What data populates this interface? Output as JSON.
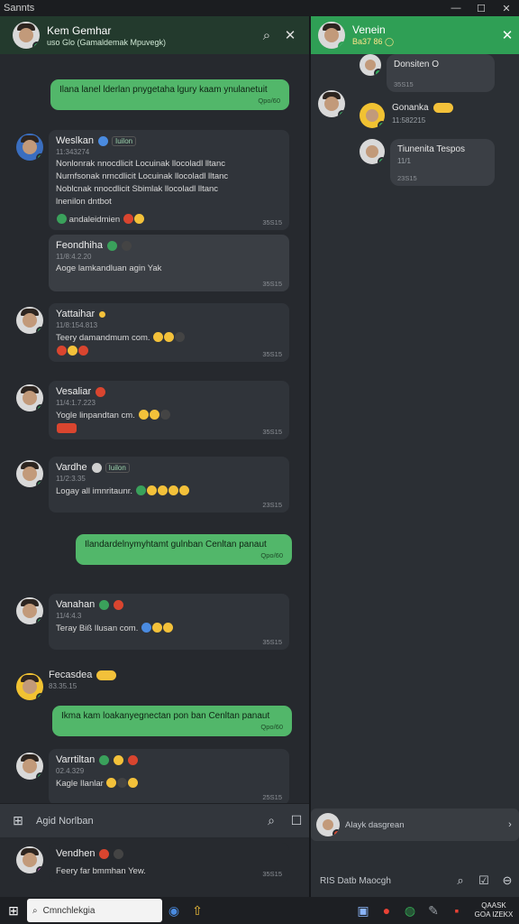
{
  "window": {
    "title": "Sannts",
    "controls": [
      "—",
      "☐",
      "✕"
    ]
  },
  "left_header": {
    "name": "Kem Gemhar",
    "subtitle": "uso Glo (Gamaldemak Mpuvegk)"
  },
  "right_header": {
    "name": "Venein",
    "subtitle": "Ba37 86 ◯"
  },
  "feed": {
    "top_stamp": "",
    "outgoing_1": {
      "text": "Ilana lanel lderlan pnygetaha lgury kaam ynulanetuit",
      "stamp": "Qpo/60"
    },
    "cards": [
      {
        "name": "Weslkan",
        "tag": "Iuilon",
        "time": "11:343274",
        "lines": [
          "Nonlonrak  nnocdlicit Locuinak  llocoladl lltanc",
          "Nurnfsonak  nrncdlicit Locuinak  llocoladl lltanc",
          "Noblcnak  nnocdlicit Sbimlak  llocoladl lltanc",
          "lnenilon  dntbot"
        ],
        "footer": "andaleidmien",
        "stamp": "35S15"
      },
      {
        "name": "Feondhiha",
        "tag": "",
        "time": "11/8:4.2.20",
        "lines": [
          "Aoge lamkandluan agin  Yak"
        ],
        "footer": "",
        "stamp": "35S15"
      },
      {
        "name": "Yattaihar",
        "tag": "",
        "time": "11/8:154.813",
        "lines": [
          "Teery damandmum  com."
        ],
        "footer": "",
        "stamp": "35S15"
      },
      {
        "name": "Vesaliar",
        "tag": "",
        "time": "11/4:1.7.223",
        "lines": [
          "Yogle  linpandtan  cm."
        ],
        "footer": "",
        "stamp": "35S15"
      },
      {
        "name": "Vardhe",
        "tag": "Iuilon",
        "time": "11/2:3.35",
        "lines": [
          "Logay all  imnritaunr."
        ],
        "footer": "",
        "stamp": "23S15"
      },
      {
        "name": "Vanahan",
        "tag": "",
        "time": "11/4:4.3",
        "lines": [
          "Teray  Biß  Ilusan  com."
        ],
        "footer": "",
        "stamp": "35S15"
      },
      {
        "name": "Fecasdea",
        "tag": "",
        "time": "83.35.15",
        "lines": [],
        "footer": "",
        "stamp": ""
      },
      {
        "name": "Varrtiltan",
        "tag": "",
        "time": "02.4.329",
        "lines": [
          "Kagle  Ilanlar"
        ],
        "footer": "",
        "stamp": "25S15"
      }
    ],
    "outgoing_2": {
      "text": "Ilandardelnymyhtamt gulnban Cenltan panaut",
      "stamp": "Qpo/60"
    },
    "outgoing_3": {
      "text": "Ikma kam  loakanyegnectan pon  ban Cenltan panaut",
      "stamp": "Qpo/60"
    }
  },
  "composer": {
    "placeholder": "Agid Norlban"
  },
  "preview": {
    "name": "Vendhen",
    "line": "Feery far  bmmhan       Yew.",
    "stamp": "35S15"
  },
  "right_panel": {
    "items": [
      {
        "name": "Donsiten  O",
        "sub": "",
        "stamp": "35S15"
      },
      {
        "name": "Gonanka",
        "sub": "11:582215",
        "stamp": ""
      },
      {
        "name": "Tiunenita  Tespos",
        "sub": "11/1",
        "stamp": "23S15"
      }
    ],
    "composer_placeholder": "Alayk dasgrean",
    "bottom_placeholder": "RIS  Datb  Maocgh"
  },
  "taskbar": {
    "search_placeholder": "Cmnchlekgia",
    "clock_line1": "QAASK",
    "clock_line2": "GOA IZEKX"
  },
  "colors": {
    "accent_green": "#52b76a",
    "header_green": "#2f9f55",
    "panel_bg": "#26292e"
  }
}
